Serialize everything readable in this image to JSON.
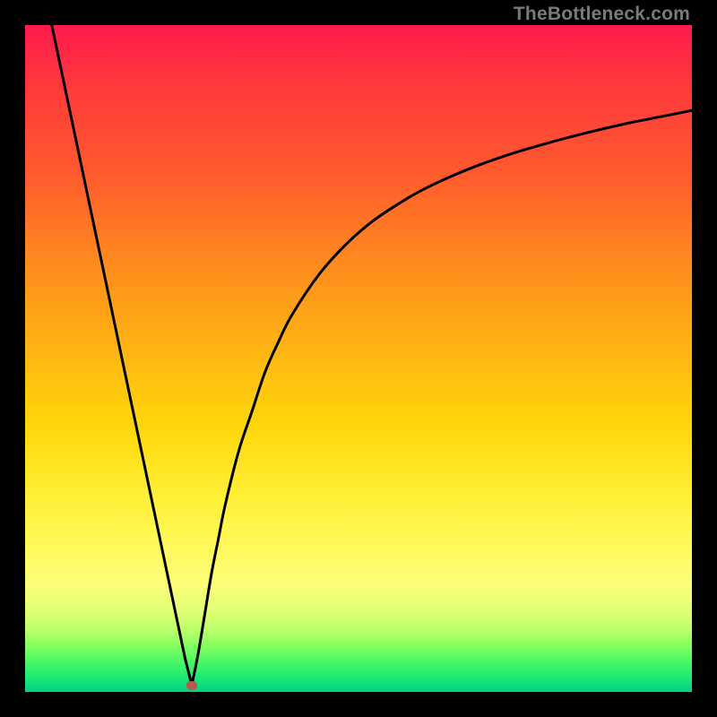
{
  "watermark": "TheBottleneck.com",
  "chart_data": {
    "type": "line",
    "title": "",
    "xlabel": "",
    "ylabel": "",
    "xlim": [
      0,
      100
    ],
    "ylim": [
      0,
      100
    ],
    "grid": false,
    "legend": false,
    "annotations": [
      {
        "name": "minimum-marker",
        "x": 25,
        "y": 1
      }
    ],
    "series": [
      {
        "name": "left-branch",
        "x": [
          4,
          6,
          8,
          10,
          12,
          14,
          16,
          18,
          20,
          22,
          24,
          25
        ],
        "y": [
          100,
          90.5,
          81,
          71.5,
          62,
          52.5,
          43,
          33.5,
          24,
          14.5,
          5,
          1
        ]
      },
      {
        "name": "right-branch",
        "x": [
          25,
          26,
          27,
          28,
          29,
          30,
          32,
          34,
          36,
          38,
          40,
          44,
          48,
          52,
          56,
          60,
          66,
          72,
          78,
          84,
          90,
          96,
          100
        ],
        "y": [
          1,
          6,
          12,
          18,
          23,
          28,
          36,
          42,
          48,
          52.5,
          56.5,
          62.5,
          67,
          70.5,
          73.2,
          75.5,
          78.2,
          80.4,
          82.2,
          83.8,
          85.2,
          86.4,
          87.2
        ]
      }
    ]
  }
}
